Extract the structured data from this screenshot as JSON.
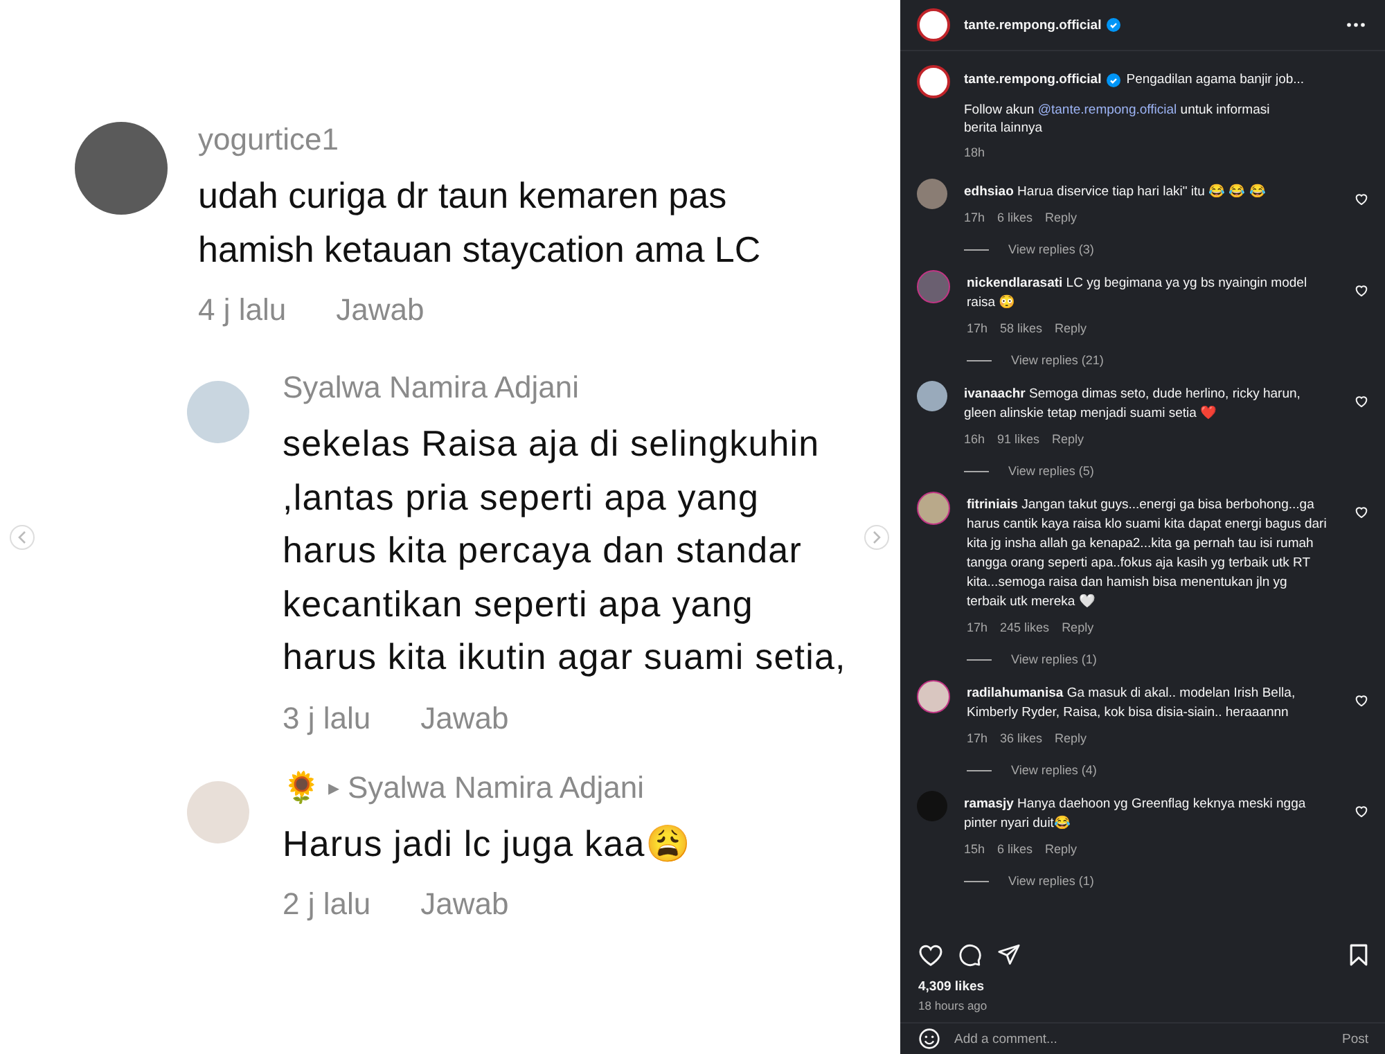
{
  "screenshot": {
    "comments": [
      {
        "user": "yogurtice1",
        "text": "udah curiga dr taun kemaren pas hamish ketauan staycation ama LC",
        "time": "4 j lalu",
        "reply": "Jawab",
        "children": [
          {
            "user": "Syalwa Namira Adjani",
            "text": "sekelas Raisa aja di selingkuhin ,lantas pria seperti apa yang harus kita percaya dan standar kecantikan seperti apa yang harus kita ikutin agar suami setia,",
            "time": "3 j lalu",
            "reply": "Jawab"
          },
          {
            "user": "🌻",
            "arrow": "▸",
            "reply_to": "Syalwa Namira Adjani",
            "text": "Harus jadi lc juga kaa😩",
            "time": "2 j lalu",
            "reply": "Jawab"
          }
        ]
      }
    ]
  },
  "post": {
    "header": {
      "user": "tante.rempong.official",
      "verified": true
    },
    "caption": {
      "user": "tante.rempong.official",
      "verified": true,
      "text": "Pengadilan agama banjir job...",
      "body_before": "Follow akun",
      "link": "@tante.rempong.official",
      "body_after": "untuk informasi berita lainnya",
      "time": "18h"
    },
    "comments": [
      {
        "user": "edhsiao",
        "text": "Harua diservice tiap hari laki\" itu 😂 😂 😂",
        "time": "17h",
        "likes": "6 likes",
        "reply": "Reply",
        "view_replies": "View replies (3)"
      },
      {
        "user": "nickendlarasati",
        "text": "LC yg begimana ya yg bs nyaingin model raisa 😳",
        "time": "17h",
        "likes": "58 likes",
        "reply": "Reply",
        "view_replies": "View replies (21)"
      },
      {
        "user": "ivanaachr",
        "text": "Semoga dimas seto, dude herlino, ricky harun, gleen alinskie tetap menjadi suami setia ❤️",
        "time": "16h",
        "likes": "91 likes",
        "reply": "Reply",
        "view_replies": "View replies (5)"
      },
      {
        "user": "fitriniais",
        "text": "Jangan takut guys...energi ga bisa berbohong...ga harus cantik kaya raisa klo suami kita dapat energi bagus dari kita jg insha allah ga kenapa2...kita ga pernah tau isi rumah tangga orang seperti apa..fokus aja kasih yg terbaik utk RT kita...semoga raisa dan hamish bisa menentukan jln yg terbaik utk mereka 🤍",
        "time": "17h",
        "likes": "245 likes",
        "reply": "Reply",
        "view_replies": "View replies (1)"
      },
      {
        "user": "radilahumanisa",
        "text": "Ga masuk di akal.. modelan Irish Bella, Kimberly Ryder, Raisa, kok bisa disia-siain.. heraaannn",
        "time": "17h",
        "likes": "36 likes",
        "reply": "Reply",
        "view_replies": "View replies (4)"
      },
      {
        "user": "ramasjy",
        "text": "Hanya daehoon yg Greenflag keknya meski ngga pinter nyari duit😂",
        "time": "15h",
        "likes": "6 likes",
        "reply": "Reply",
        "view_replies": "View replies (1)"
      }
    ],
    "likes": "4,309 likes",
    "time": "18 hours ago",
    "add_comment": {
      "placeholder": "Add a comment...",
      "button": "Post"
    }
  }
}
